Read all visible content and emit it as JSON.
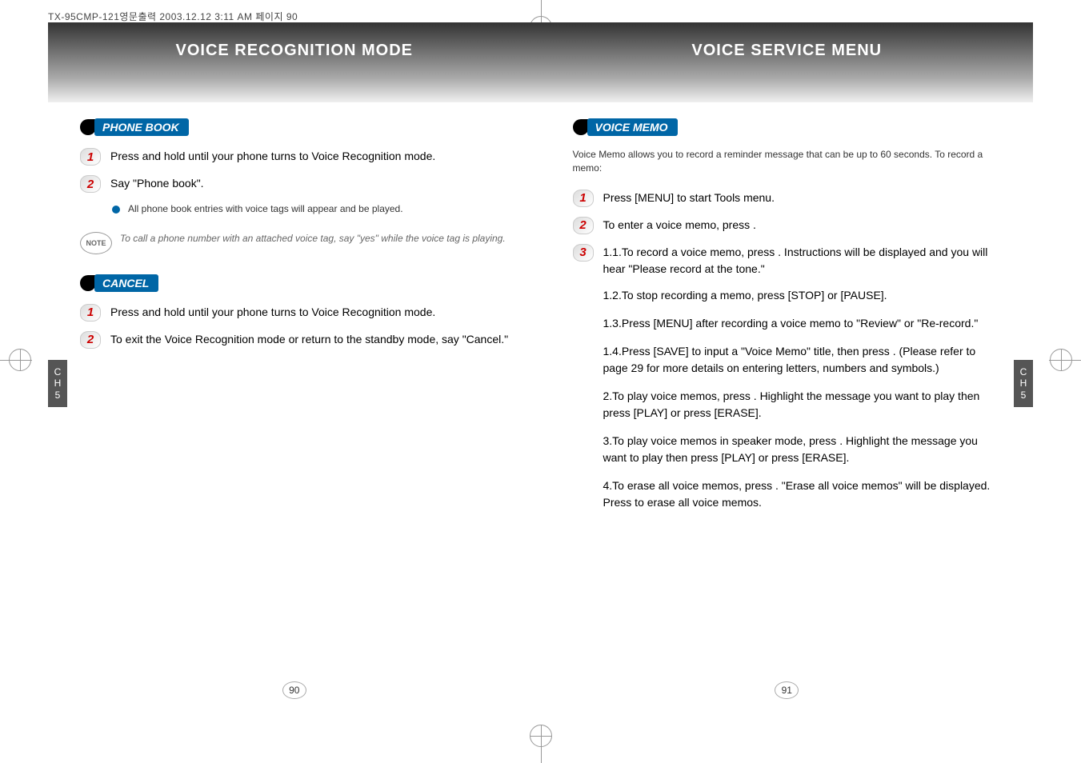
{
  "header": "TX-95CMP-121영문출력  2003.12.12 3:11 AM  페이지 90",
  "leftPage": {
    "bannerTitle": "VOICE RECOGNITION MODE",
    "section1": {
      "label": "PHONE BOOK",
      "step1": "Press and hold      until your phone turns to Voice Recognition mode.",
      "step2": "Say \"Phone book\".",
      "noteBullet": "All phone book entries with voice tags will appear and be played.",
      "noteBadge": "NOTE",
      "noteItalic": "To call a phone number with an attached voice tag, say \"yes\" while the voice tag is playing."
    },
    "section2": {
      "label": "CANCEL",
      "step1": "Press and hold      until your phone turns to Voice Recognition mode.",
      "step2": "To exit the Voice Recognition mode or return to the standby mode, say \"Cancel.\""
    },
    "chTab": "C\nH\n5",
    "pageNumber": "90"
  },
  "rightPage": {
    "bannerTitle": "VOICE SERVICE MENU",
    "section1": {
      "label": "VOICE MEMO",
      "intro": "Voice Memo allows you to record a reminder message that can be up to 60 seconds.  To record a memo:",
      "step1": "Press     [MENU]      to start Tools menu.",
      "step2": "To enter a voice memo, press       .",
      "step3_1": "1.1.To record a voice memo, press       . Instructions will be displayed and you will hear \"Please record at the tone.\"",
      "step3_2": "1.2.To stop recording a memo, press     [STOP] or      [PAUSE].",
      "step3_3": "1.3.Press     [MENU] after recording a voice memo to \"Review\" or \"Re-record.\"",
      "step3_4": "1.4.Press     [SAVE] to input a \"Voice Memo\" title, then press     . (Please refer to page 29 for more details on entering letters, numbers and symbols.)",
      "step3_5": "2.To play voice memos, press       . Highlight the message you want to play then press     [PLAY] or press      [ERASE].",
      "step3_6": "3.To play voice memos in speaker mode, press       . Highlight the message you want to play then press     [PLAY] or press      [ERASE].",
      "step3_7": "4.To erase all voice memos, press       . \"Erase all voice memos\" will be displayed. Press     to erase all voice memos."
    },
    "chTab": "C\nH\n5",
    "pageNumber": "91"
  }
}
